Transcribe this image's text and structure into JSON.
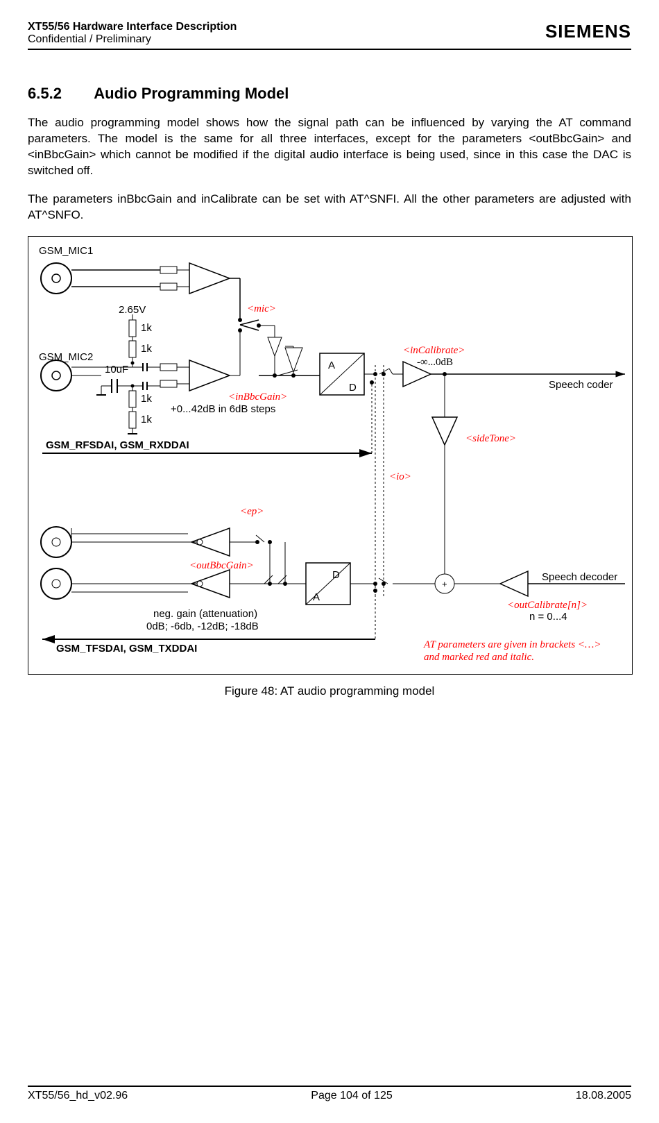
{
  "header": {
    "title": "XT55/56 Hardware Interface Description",
    "subtitle": "Confidential / Preliminary",
    "logo": "SIEMENS"
  },
  "section": {
    "number": "6.5.2",
    "title": "Audio Programming Model"
  },
  "paragraphs": {
    "p1": "The audio programming model shows how the signal path can be influenced by varying the AT command parameters. The model is the same for all three interfaces, except for the parameters <outBbcGain> and <inBbcGain> which cannot be modified if the digital audio interface is being used, since in this case the DAC is switched off.",
    "p2": "The parameters inBbcGain and inCalibrate can be set with AT^SNFI. All the other parameters are adjusted with AT^SNFO."
  },
  "figure": {
    "caption": "Figure 48: AT audio programming model",
    "labels": {
      "gsm_mic1": "GSM_MIC1",
      "gsm_mic2": "GSM_MIC2",
      "v_2_65": "2.65V",
      "r_1k_a": "1k",
      "r_1k_b": "1k",
      "r_1k_c": "1k",
      "r_1k_d": "1k",
      "c_10uf": "10uF",
      "mic": "<mic>",
      "inBbcGain": "<inBbcGain>",
      "inBbcGain_note": "+0...42dB in 6dB steps",
      "inCalibrate": "<inCalibrate>",
      "inCalibrate_note": "-∞...0dB",
      "ad_a": "A",
      "ad_d": "D",
      "da_d": "D",
      "da_a": "A",
      "speech_coder": "Speech coder",
      "speech_decoder": "Speech decoder",
      "sideTone": "<sideTone>",
      "io": "<io>",
      "ep": "<ep>",
      "outBbcGain": "<outBbcGain>",
      "neg_gain_1": "neg. gain (attenuation)",
      "neg_gain_2": "0dB; -6db, -12dB; -18dB",
      "outCalibrate": "<outCalibrate[n]>",
      "outCalibrate_note": "n = 0...4",
      "gsm_rfsdai": "GSM_RFSDAI, GSM_RXDDAI",
      "gsm_tfsdai": "GSM_TFSDAI, GSM_TXDDAI",
      "at_note_1": "AT parameters are given in brackets <…>",
      "at_note_2": "and marked red and italic."
    }
  },
  "footer": {
    "left": "XT55/56_hd_v02.96",
    "center": "Page 104 of 125",
    "right": "18.08.2005"
  }
}
